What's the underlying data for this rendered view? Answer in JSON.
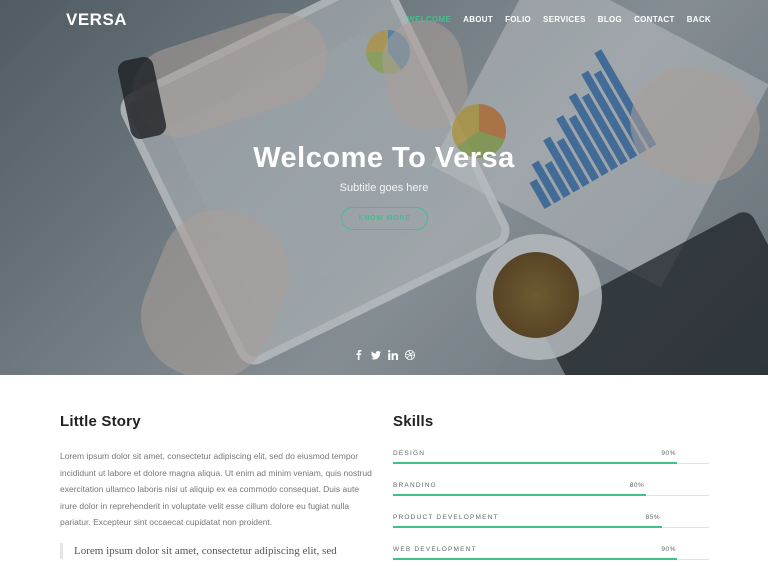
{
  "brand": {
    "logo": "VERSA",
    "accent": "#3fc08c"
  },
  "nav": {
    "items": [
      {
        "label": "WELCOME",
        "active": true
      },
      {
        "label": "ABOUT",
        "active": false
      },
      {
        "label": "FOLIO",
        "active": false
      },
      {
        "label": "SERVICES",
        "active": false
      },
      {
        "label": "BLOG",
        "active": false
      },
      {
        "label": "CONTACT",
        "active": false
      },
      {
        "label": "BACK",
        "active": false
      }
    ]
  },
  "hero": {
    "title": "Welcome To Versa",
    "subtitle": "Subtitle goes here",
    "cta": "KNOW MORE",
    "social": [
      "facebook-icon",
      "twitter-icon",
      "linkedin-icon",
      "dribbble-icon"
    ]
  },
  "story": {
    "title": "Little Story",
    "text": "Lorem ipsum dolor sit amet, consectetur adipiscing elit, sed do eiusmod tempor incididunt ut labore et dolore magna aliqua. Ut enim ad minim veniam, quis nostrud exercitation ullamco laboris nisi ut aliquip ex ea commodo consequat. Duis aute irure dolor in reprehenderit in voluptate velit esse cillum dolore eu fugiat nulla pariatur. Excepteur sint occaecat cupidatat non proident.",
    "quote": "Lorem ipsum dolor sit amet, consectetur adipiscing elit, sed"
  },
  "skills": {
    "title": "Skills",
    "items": [
      {
        "name": "DESIGN",
        "percent": 90,
        "label": "90%"
      },
      {
        "name": "BRANDING",
        "percent": 80,
        "label": "80%"
      },
      {
        "name": "PRODUCT DEVELOPMENT",
        "percent": 85,
        "label": "85%"
      },
      {
        "name": "WEB DEVELOPMENT",
        "percent": 90,
        "label": "90%"
      }
    ]
  }
}
